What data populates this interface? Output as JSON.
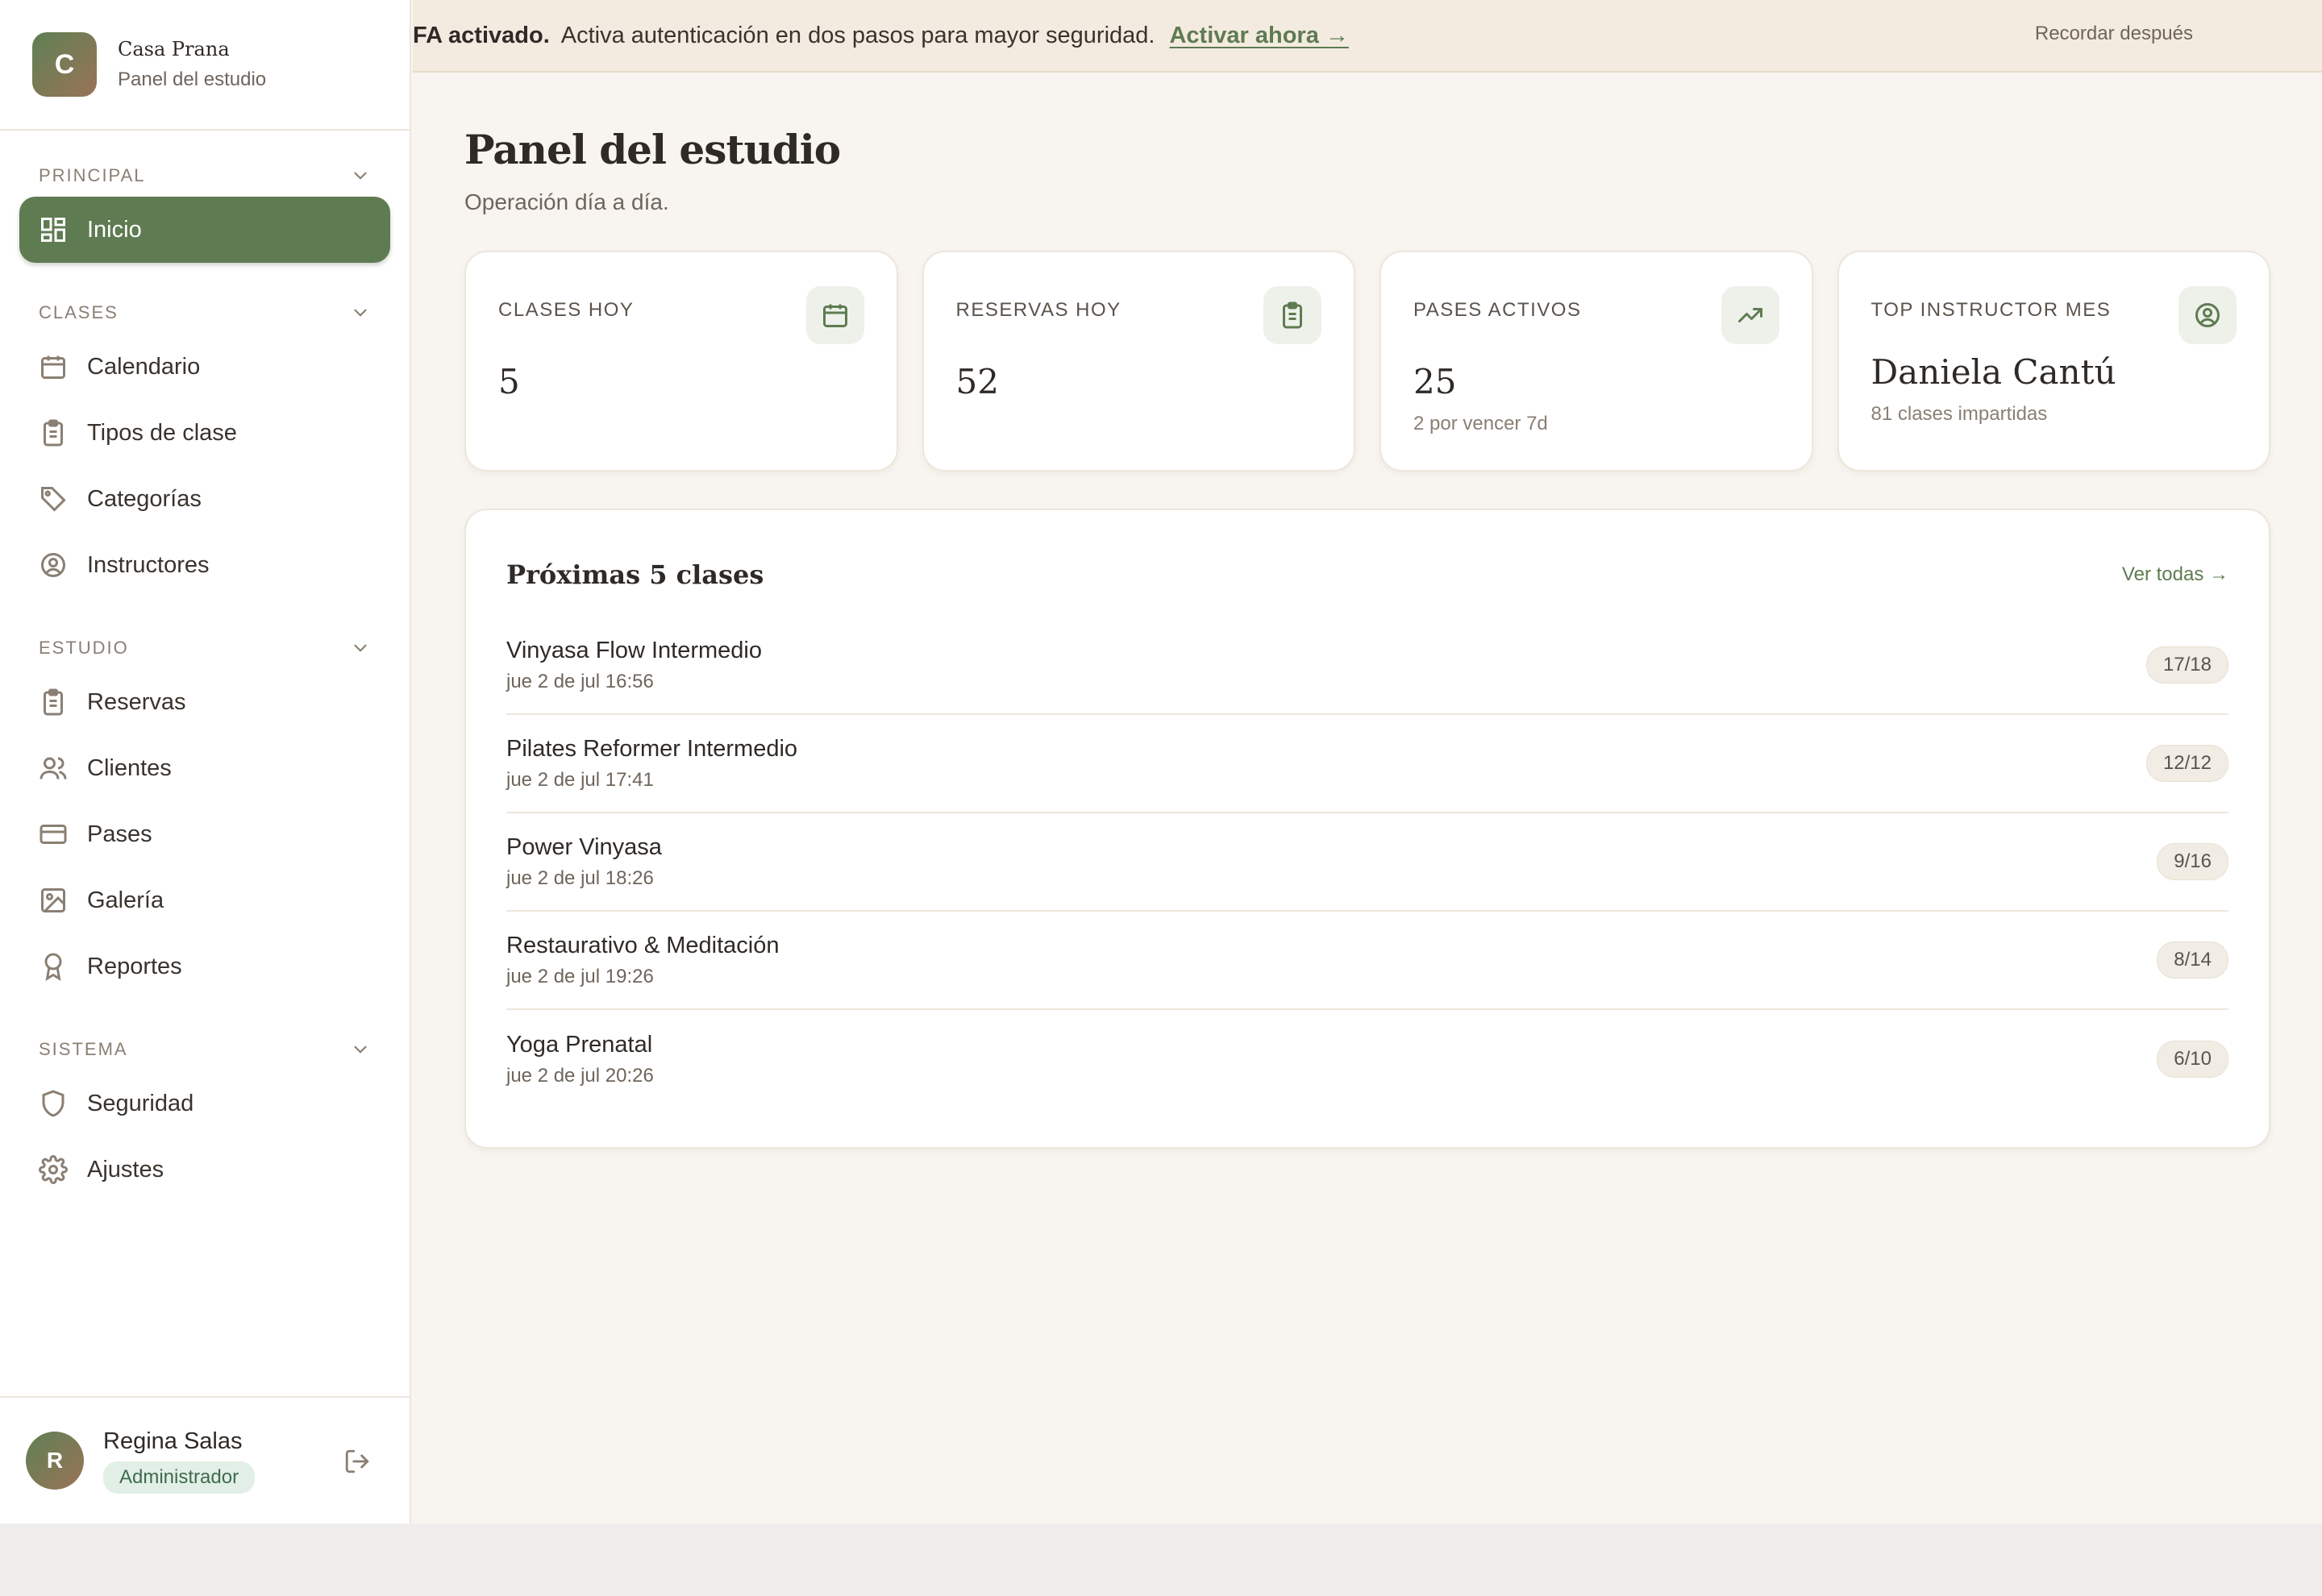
{
  "brand": {
    "initial": "C",
    "name": "Casa Prana",
    "subtitle": "Panel del estudio"
  },
  "sidebar": {
    "sections": [
      {
        "title": "PRINCIPAL",
        "items": [
          {
            "label": "Inicio",
            "icon": "dashboard-icon",
            "active": true
          }
        ]
      },
      {
        "title": "CLASES",
        "items": [
          {
            "label": "Calendario",
            "icon": "calendar-icon"
          },
          {
            "label": "Tipos de clase",
            "icon": "clipboard-icon"
          },
          {
            "label": "Categorías",
            "icon": "tag-icon"
          },
          {
            "label": "Instructores",
            "icon": "user-circle-icon"
          }
        ]
      },
      {
        "title": "ESTUDIO",
        "items": [
          {
            "label": "Reservas",
            "icon": "clipboard-icon"
          },
          {
            "label": "Clientes",
            "icon": "users-icon"
          },
          {
            "label": "Pases",
            "icon": "credit-card-icon"
          },
          {
            "label": "Galería",
            "icon": "image-icon"
          },
          {
            "label": "Reportes",
            "icon": "award-icon"
          }
        ]
      },
      {
        "title": "SISTEMA",
        "items": [
          {
            "label": "Seguridad",
            "icon": "shield-icon"
          },
          {
            "label": "Ajustes",
            "icon": "gear-icon"
          }
        ]
      }
    ]
  },
  "user": {
    "initial": "R",
    "name": "Regina Salas",
    "role": "Administrador"
  },
  "banner": {
    "strong": "FA activado.",
    "message": "Activa autenticación en dos pasos para mayor seguridad.",
    "cta": "Activar ahora →",
    "dismiss": "Recordar después"
  },
  "page": {
    "title": "Panel del estudio",
    "subtitle": "Operación día a día."
  },
  "stats": [
    {
      "label": "CLASES HOY",
      "value": "5",
      "note": "",
      "icon": "calendar-icon"
    },
    {
      "label": "RESERVAS HOY",
      "value": "52",
      "note": "",
      "icon": "clipboard-icon"
    },
    {
      "label": "PASES ACTIVOS",
      "value": "25",
      "note": "2 por vencer 7d",
      "icon": "trending-up-icon"
    },
    {
      "label": "TOP INSTRUCTOR MES",
      "value": "Daniela Cantú",
      "note": "81 clases impartidas",
      "icon": "user-circle-icon"
    }
  ],
  "upcoming": {
    "title": "Próximas 5 clases",
    "link": "Ver todas →",
    "classes": [
      {
        "name": "Vinyasa Flow Intermedio",
        "time": "jue 2 de jul 16:56",
        "capacity": "17/18"
      },
      {
        "name": "Pilates Reformer Intermedio",
        "time": "jue 2 de jul 17:41",
        "capacity": "12/12"
      },
      {
        "name": "Power Vinyasa",
        "time": "jue 2 de jul 18:26",
        "capacity": "9/16"
      },
      {
        "name": "Restaurativo & Meditación",
        "time": "jue 2 de jul 19:26",
        "capacity": "8/14"
      },
      {
        "name": "Yoga Prenatal",
        "time": "jue 2 de jul 20:26",
        "capacity": "6/10"
      }
    ]
  },
  "colors": {
    "accent": "#5f7b52",
    "background": "#f8f5f0",
    "banner": "#f3ebe0"
  }
}
